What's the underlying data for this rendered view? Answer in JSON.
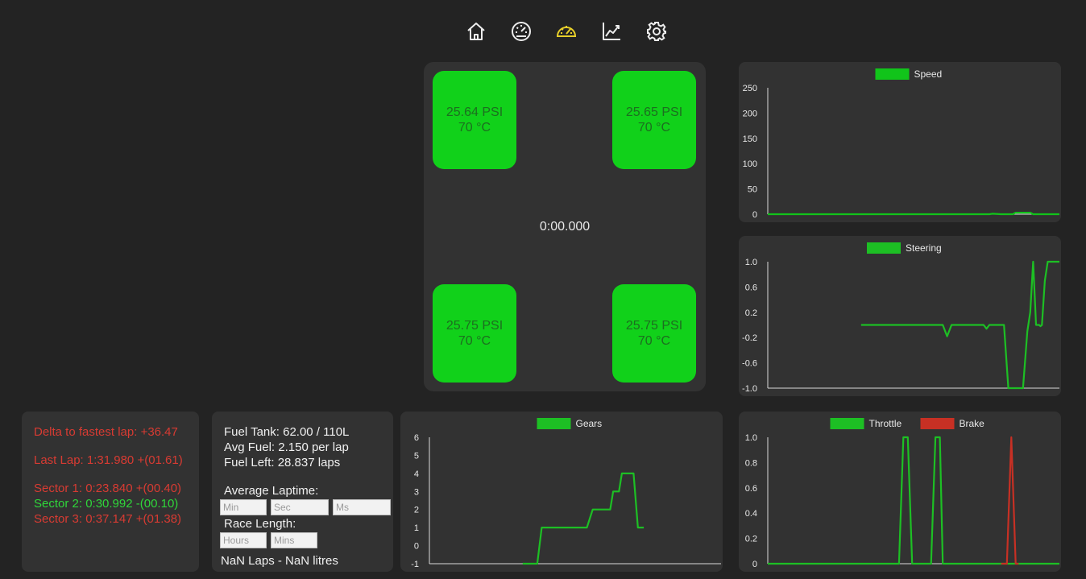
{
  "nav": {
    "items": [
      {
        "name": "home-icon",
        "active": false
      },
      {
        "name": "dashboard-gauge-icon",
        "active": false
      },
      {
        "name": "speedometer-icon",
        "active": true
      },
      {
        "name": "line-chart-icon",
        "active": false
      },
      {
        "name": "gear-icon",
        "active": false
      }
    ],
    "active_color": "#e7cf2a",
    "inactive_color": "#ececec"
  },
  "tires": [
    {
      "pressure": "25.64 PSI",
      "temp": "70 °C"
    },
    {
      "pressure": "25.65 PSI",
      "temp": "70 °C"
    },
    {
      "pressure": "25.75 PSI",
      "temp": "70 °C"
    },
    {
      "pressure": "25.75 PSI",
      "temp": "70 °C"
    }
  ],
  "timer": "0:00.000",
  "laps": {
    "delta": "Delta to fastest lap: +36.47",
    "last_lap": "Last Lap: 1:31.980 +(01.61)",
    "sector1": "Sector 1: 0:23.840 +(00.40)",
    "sector2": "Sector 2: 0:30.992 -(00.10)",
    "sector3": "Sector 3: 0:37.147 +(01.38)",
    "red": "#d83b32",
    "green": "#2fd63a"
  },
  "fuel": {
    "tank": "Fuel Tank: 62.00 / 110L",
    "avg": "Avg Fuel: 2.150 per lap",
    "left": "Fuel Left: 28.837 laps",
    "avg_laptime_label": "Average Laptime:",
    "min_placeholder": "Min",
    "sec_placeholder": "Sec",
    "ms_placeholder": "Ms",
    "race_length_label": "Race Length:",
    "hours_placeholder": "Hours",
    "mins_placeholder": "Mins",
    "result": "NaN Laps - NaN litres"
  },
  "chart_data": [
    {
      "type": "line",
      "title": "",
      "ylim": [
        0,
        250
      ],
      "yticks": [
        0,
        50,
        100,
        150,
        200,
        250
      ],
      "series": [
        {
          "name": "Speed",
          "color": "#11c41a",
          "points": [
            [
              0,
              0
            ],
            [
              0.76,
              0
            ],
            [
              0.77,
              1
            ],
            [
              0.8,
              0
            ],
            [
              0.84,
              0
            ],
            [
              0.85,
              3
            ],
            [
              0.9,
              3
            ],
            [
              0.91,
              0
            ],
            [
              1,
              0
            ]
          ]
        }
      ]
    },
    {
      "type": "line",
      "title": "",
      "ylim": [
        -1,
        1
      ],
      "yticks": [
        "-1.0",
        "-0.6",
        "-0.2",
        "0.2",
        "0.6",
        "1.0"
      ],
      "series": [
        {
          "name": "Steering",
          "color": "#1dbf24",
          "points": [
            [
              0.32,
              0
            ],
            [
              0.6,
              0
            ],
            [
              0.615,
              -0.18
            ],
            [
              0.63,
              0
            ],
            [
              0.74,
              0
            ],
            [
              0.75,
              -0.06
            ],
            [
              0.76,
              0
            ],
            [
              0.81,
              0
            ],
            [
              0.825,
              -1
            ],
            [
              0.875,
              -1
            ],
            [
              0.89,
              -0.1
            ],
            [
              0.9,
              0.2
            ],
            [
              0.91,
              1
            ],
            [
              0.92,
              0
            ],
            [
              0.93,
              0
            ],
            [
              0.935,
              -0.02
            ],
            [
              0.94,
              0
            ],
            [
              0.95,
              0.7
            ],
            [
              0.96,
              1
            ],
            [
              1,
              1
            ]
          ]
        }
      ]
    },
    {
      "type": "line",
      "title": "",
      "ylim": [
        -1,
        6
      ],
      "yticks": [
        -1,
        0,
        1,
        2,
        3,
        4,
        5,
        6
      ],
      "series": [
        {
          "name": "Gears",
          "color": "#1dbf24",
          "points": [
            [
              0.32,
              -1
            ],
            [
              0.37,
              -1
            ],
            [
              0.385,
              1
            ],
            [
              0.54,
              1
            ],
            [
              0.56,
              2
            ],
            [
              0.62,
              2
            ],
            [
              0.63,
              3
            ],
            [
              0.65,
              3
            ],
            [
              0.66,
              4
            ],
            [
              0.7,
              4
            ],
            [
              0.715,
              1
            ],
            [
              0.735,
              1
            ]
          ]
        }
      ]
    },
    {
      "type": "line",
      "title": "",
      "ylim": [
        0,
        1
      ],
      "yticks": [
        "0",
        "0.2",
        "0.4",
        "0.6",
        "0.8",
        "1.0"
      ],
      "series": [
        {
          "name": "Throttle",
          "color": "#1dbf24",
          "points": [
            [
              0,
              0
            ],
            [
              0.45,
              0
            ],
            [
              0.465,
              1
            ],
            [
              0.48,
              1
            ],
            [
              0.495,
              0
            ],
            [
              0.56,
              0
            ],
            [
              0.575,
              1
            ],
            [
              0.59,
              1
            ],
            [
              0.6,
              0
            ],
            [
              1,
              0
            ]
          ]
        },
        {
          "name": "Brake",
          "color": "#c73024",
          "points": [
            [
              0.8,
              0
            ],
            [
              0.82,
              0
            ],
            [
              0.835,
              1
            ],
            [
              0.85,
              0
            ],
            [
              0.86,
              0
            ]
          ]
        }
      ]
    }
  ]
}
